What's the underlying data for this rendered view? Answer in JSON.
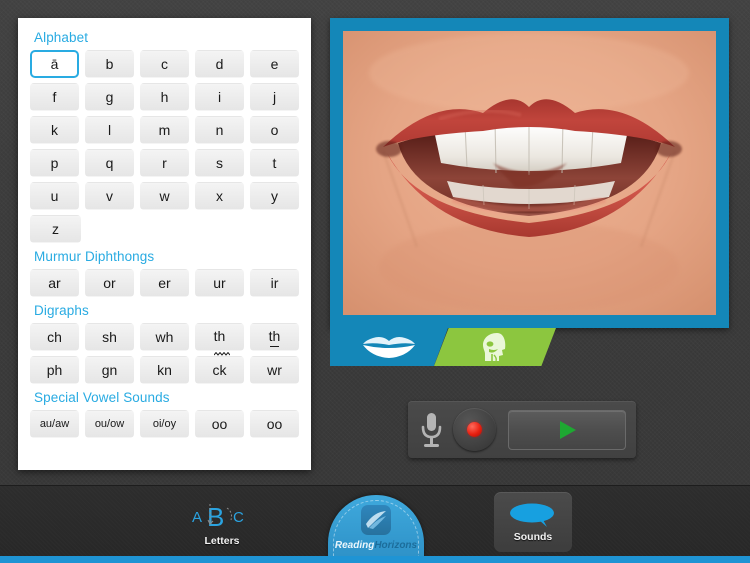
{
  "app": {
    "name": "Reading Horizons Discovery",
    "logo_text_a": "Reading",
    "logo_text_b": "Horizons",
    "accent_blue": "#29abe2",
    "frame_blue": "#1487b8",
    "tab_green": "#8cc63f",
    "nav_strip_blue": "#1f94d4"
  },
  "letters_panel": {
    "groups": [
      {
        "title": "Alphabet",
        "rows": [
          [
            {
              "label": "ā",
              "selected": true
            },
            {
              "label": "b",
              "selected": false
            },
            {
              "label": "c",
              "selected": false
            },
            {
              "label": "d",
              "selected": false
            },
            {
              "label": "e",
              "selected": false
            }
          ],
          [
            {
              "label": "f",
              "selected": false
            },
            {
              "label": "g",
              "selected": false
            },
            {
              "label": "h",
              "selected": false
            },
            {
              "label": "i",
              "selected": false
            },
            {
              "label": "j",
              "selected": false
            }
          ],
          [
            {
              "label": "k",
              "selected": false
            },
            {
              "label": "l",
              "selected": false
            },
            {
              "label": "m",
              "selected": false
            },
            {
              "label": "n",
              "selected": false
            },
            {
              "label": "o",
              "selected": false
            }
          ],
          [
            {
              "label": "p",
              "selected": false
            },
            {
              "label": "q",
              "selected": false
            },
            {
              "label": "r",
              "selected": false
            },
            {
              "label": "s",
              "selected": false
            },
            {
              "label": "t",
              "selected": false
            }
          ],
          [
            {
              "label": "u",
              "selected": false
            },
            {
              "label": "v",
              "selected": false
            },
            {
              "label": "w",
              "selected": false
            },
            {
              "label": "x",
              "selected": false
            },
            {
              "label": "y",
              "selected": false
            }
          ],
          [
            {
              "label": "z",
              "selected": false
            }
          ]
        ]
      },
      {
        "title": "Murmur Diphthongs",
        "rows": [
          [
            {
              "label": "ar",
              "selected": false
            },
            {
              "label": "or",
              "selected": false
            },
            {
              "label": "er",
              "selected": false
            },
            {
              "label": "ur",
              "selected": false
            },
            {
              "label": "ir",
              "selected": false
            }
          ]
        ]
      },
      {
        "title": "Digraphs",
        "rows": [
          [
            {
              "label": "ch",
              "selected": false
            },
            {
              "label": "sh",
              "selected": false
            },
            {
              "label": "wh",
              "selected": false
            },
            {
              "label": "th",
              "selected": false,
              "mark": "wave"
            },
            {
              "label": "th",
              "selected": false,
              "mark": "line"
            }
          ],
          [
            {
              "label": "ph",
              "selected": false
            },
            {
              "label": "gn",
              "selected": false
            },
            {
              "label": "kn",
              "selected": false
            },
            {
              "label": "ck",
              "selected": false
            },
            {
              "label": "wr",
              "selected": false
            }
          ]
        ]
      },
      {
        "title": "Special Vowel Sounds",
        "rows": [
          [
            {
              "label": "au/aw",
              "selected": false,
              "small": true
            },
            {
              "label": "ou/ow",
              "selected": false,
              "small": true
            },
            {
              "label": "oi/oy",
              "selected": false,
              "small": true
            },
            {
              "label": "oo",
              "selected": false
            },
            {
              "label": "oo",
              "selected": false
            }
          ]
        ]
      }
    ]
  },
  "media": {
    "view_name": "mouth-photo",
    "description": "Close-up photograph of an open mouth with red lips showing upper and lower teeth"
  },
  "view_tabs": [
    {
      "name": "lips-view",
      "icon": "lips-icon",
      "active": true
    },
    {
      "name": "anatomy-view",
      "icon": "head-profile-icon",
      "active": false
    }
  ],
  "audio_controls": {
    "microphone_icon": "microphone-icon",
    "record_icon": "record-icon",
    "play_icon": "play-icon"
  },
  "bottom_nav": {
    "letters": {
      "label": "Letters",
      "icon": "abc-icon",
      "active": false
    },
    "sounds": {
      "label": "Sounds",
      "icon": "speech-bubble-icon",
      "active": true
    }
  }
}
